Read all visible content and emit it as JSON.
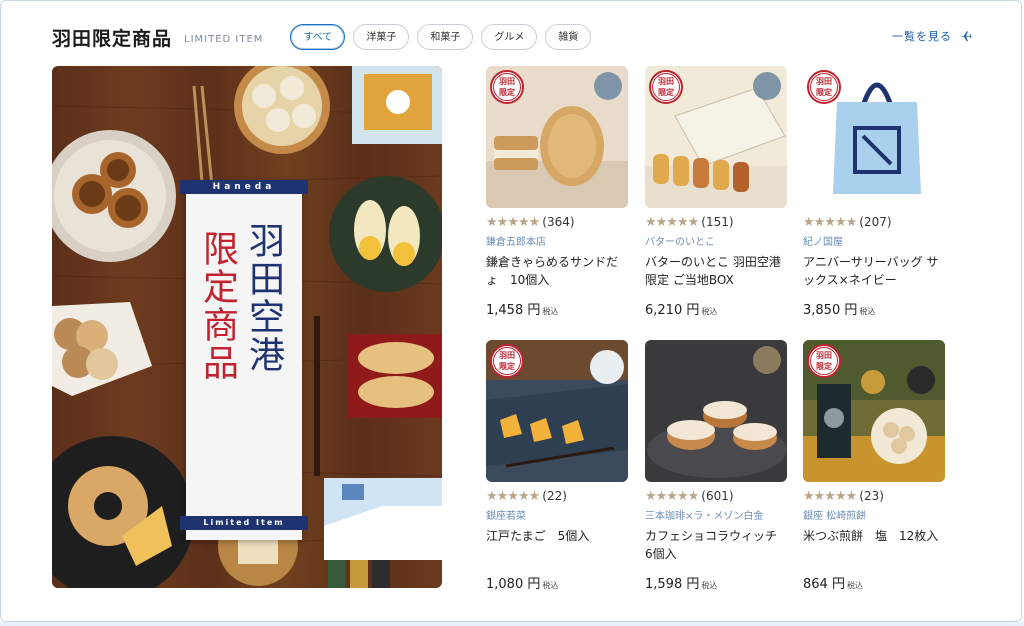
{
  "header": {
    "title": "羽田限定商品",
    "subtitle": "LIMITED ITEM",
    "see_all": "一覧を見る"
  },
  "tabs": [
    {
      "label": "すべて",
      "active": true
    },
    {
      "label": "洋菓子",
      "active": false
    },
    {
      "label": "和菓子",
      "active": false
    },
    {
      "label": "グルメ",
      "active": false
    },
    {
      "label": "雑貨",
      "active": false
    }
  ],
  "hero": {
    "top_band": "Haneda",
    "col_right": "羽田空港",
    "col_left": "限定商品",
    "bottom_band": "Limited Item"
  },
  "badge": {
    "line1": "羽田",
    "line2": "限定"
  },
  "products": [
    {
      "rating_stars": "★★★★★",
      "count": "(364)",
      "shop": "鎌倉五郎本店",
      "name": "鎌倉きゃらめるサンドだょ　10個入",
      "price": "1,458 円",
      "tax": "税込",
      "color": "#e9dccb"
    },
    {
      "rating_stars": "★★★★★",
      "count": "(151)",
      "shop": "バターのいとこ",
      "name": "バターのいとこ 羽田空港限定 ご当地BOX",
      "price": "6,210 円",
      "tax": "税込",
      "color": "#f1ead9"
    },
    {
      "rating_stars": "★★★★★",
      "count": "(207)",
      "shop": "紀ノ国屋",
      "name": "アニバーサリーバッグ サックス×ネイビー",
      "price": "3,850 円",
      "tax": "税込",
      "color": "#ffffff"
    },
    {
      "rating_stars": "★★★★★",
      "count": "(22)",
      "shop": "銀座若菜",
      "name": "江戸たまご　5個入",
      "price": "1,080 円",
      "tax": "税込",
      "color": "#3b4a5c"
    },
    {
      "rating_stars": "★★★★★",
      "count": "(601)",
      "shop": "三本珈琲×ラ・メゾン白金",
      "name": "カフェショコラウィッチ 6個入",
      "price": "1,598 円",
      "tax": "税込",
      "color": "#3a3a3d"
    },
    {
      "rating_stars": "★★★★★",
      "count": "(23)",
      "shop": "銀座 松崎煎餅",
      "name": "米つぶ煎餅　塩　12枚入",
      "price": "864 円",
      "tax": "税込",
      "color": "#6f6b35"
    }
  ]
}
